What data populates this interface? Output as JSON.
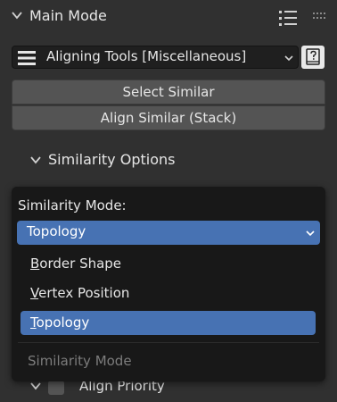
{
  "panel": {
    "title": "Main Mode",
    "addon_label": "Aligning Tools [Miscellaneous]"
  },
  "buttons": {
    "select_similar": "Select Similar",
    "align_similar": "Align Similar (Stack)"
  },
  "subpanel": {
    "title": "Similarity Options"
  },
  "popup": {
    "title": "Similarity Mode:",
    "selected_value": "Topology",
    "options": [
      {
        "first": "B",
        "rest": "order Shape"
      },
      {
        "first": "V",
        "rest": "ertex Position"
      },
      {
        "first": "T",
        "rest": "opology"
      }
    ],
    "footer": "Similarity Mode"
  },
  "bottom_row": {
    "label": "Align Priority"
  },
  "colors": {
    "background": "#303030",
    "popup_bg": "#181818",
    "accent": "#4772b3",
    "button": "#545454"
  },
  "icons": [
    "chevron-down-icon",
    "list-icon",
    "drag-grip-icon",
    "hamburger-menu-icon",
    "help-book-icon"
  ]
}
